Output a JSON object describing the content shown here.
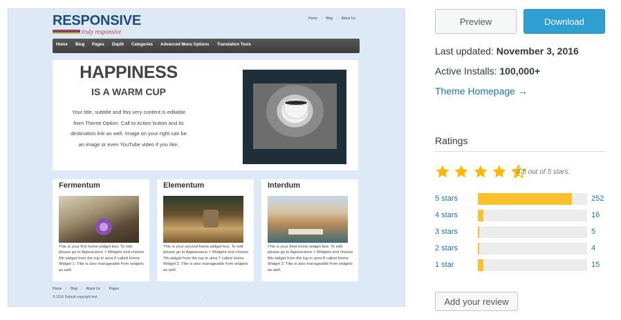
{
  "preview": {
    "logo": {
      "main": "RESPONSIVE",
      "sub": "truly responsive",
      "bar_colors": [
        "#d4382c",
        "#2b5e9e",
        "#e8b12b"
      ]
    },
    "top_links": [
      "Home",
      "Blog",
      "About Us"
    ],
    "nav": [
      "Home",
      "Blog",
      "Pages",
      "Depth",
      "Categories",
      "Advanced Menu Options",
      "Translation Tests"
    ],
    "hero": {
      "title": "HAPPINESS",
      "subtitle": "IS A WARM CUP",
      "text": "Your title, subtitle and this very content is editable from Theme Option. Call to Action button and its destination link as well. Image on your right can be an image or even YouTube video if you like."
    },
    "widgets": [
      {
        "title": "Fermentum",
        "text": "This is your first home widget box. To edit please go to Appearance > Widgets and choose 6th widget from the top in area 6 called Home Widget 1. Title is also manageable from widgets as well."
      },
      {
        "title": "Elementum",
        "text": "This is your second home widget box. To edit please go to Appearance > Widgets and choose 7th widget from the top in area 7 called Home Widget 2. Title is also manageable from widgets as well."
      },
      {
        "title": "Interdum",
        "text": "This is your third home widget box. To edit please go to Appearance > Widgets and choose 8th widget from the top in area 8 called Home Widget 3. Title is also manageable from widgets as well."
      }
    ],
    "footer_links": [
      "Home",
      "Blog",
      "About Us",
      "Pages"
    ],
    "copyright": "© 2016 Default copyright text",
    "footer_dot": "↑"
  },
  "sidebar": {
    "preview_label": "Preview",
    "download_label": "Download",
    "last_updated_label": "Last updated:",
    "last_updated_value": "November 3, 2016",
    "installs_label": "Active Installs:",
    "installs_value": "100,000+",
    "homepage_link": "Theme Homepage →",
    "ratings_title": "Ratings",
    "stars_text": "4.5 out of 5 stars.",
    "rating_value": 4.5,
    "star_color": "#ffb900",
    "bar_color": "#fbc02d",
    "ratings": [
      {
        "label": "5 stars",
        "count": "252",
        "fraction": 0.86
      },
      {
        "label": "4 stars",
        "count": "16",
        "fraction": 0.05
      },
      {
        "label": "3 stars",
        "count": "5",
        "fraction": 0.015
      },
      {
        "label": "2 stars",
        "count": "4",
        "fraction": 0.012
      },
      {
        "label": "1 star",
        "count": "15",
        "fraction": 0.05
      }
    ],
    "add_review_label": "Add your review"
  }
}
